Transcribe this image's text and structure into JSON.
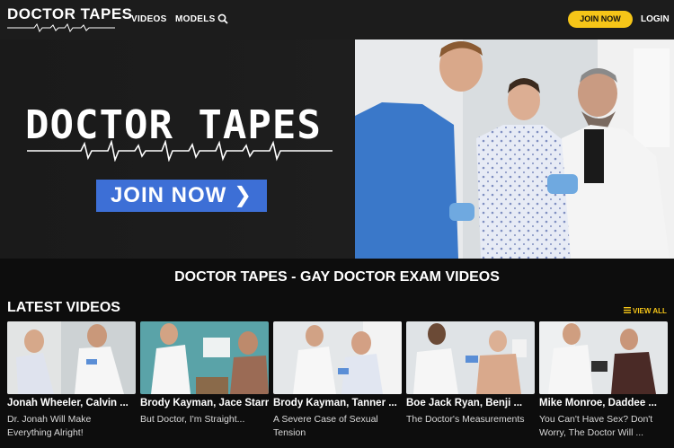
{
  "nav": {
    "logo": "DOCTOR TAPES",
    "links": [
      "VIDEOS",
      "MODELS"
    ],
    "join": "JOIN NOW",
    "login": "LOGIN"
  },
  "hero": {
    "title": "DOCTOR TAPES",
    "cta": "JOIN NOW ❯"
  },
  "page_title": "DOCTOR TAPES - GAY DOCTOR EXAM VIDEOS",
  "latest": {
    "heading": "LATEST VIDEOS",
    "view_all": "VIEW ALL",
    "videos": [
      {
        "title": "Jonah Wheeler, Calvin ...",
        "subtitle": "Dr. Jonah Will Make Everything Alright!"
      },
      {
        "title": "Brody Kayman, Jace Starr",
        "subtitle": "But Doctor, I'm Straight..."
      },
      {
        "title": "Brody Kayman, Tanner ...",
        "subtitle": "A Severe Case of Sexual Tension"
      },
      {
        "title": "Boe Jack Ryan, Benji ...",
        "subtitle": "The Doctor's Measurements"
      },
      {
        "title": "Mike Monroe, Daddee ...",
        "subtitle": "You Can't Have Sex? Don't Worry, The Doctor Will ..."
      }
    ]
  },
  "colors": {
    "accent": "#f5c518",
    "cta_blue": "#3d6fd6",
    "scrub_blue": "#3a78c9"
  }
}
